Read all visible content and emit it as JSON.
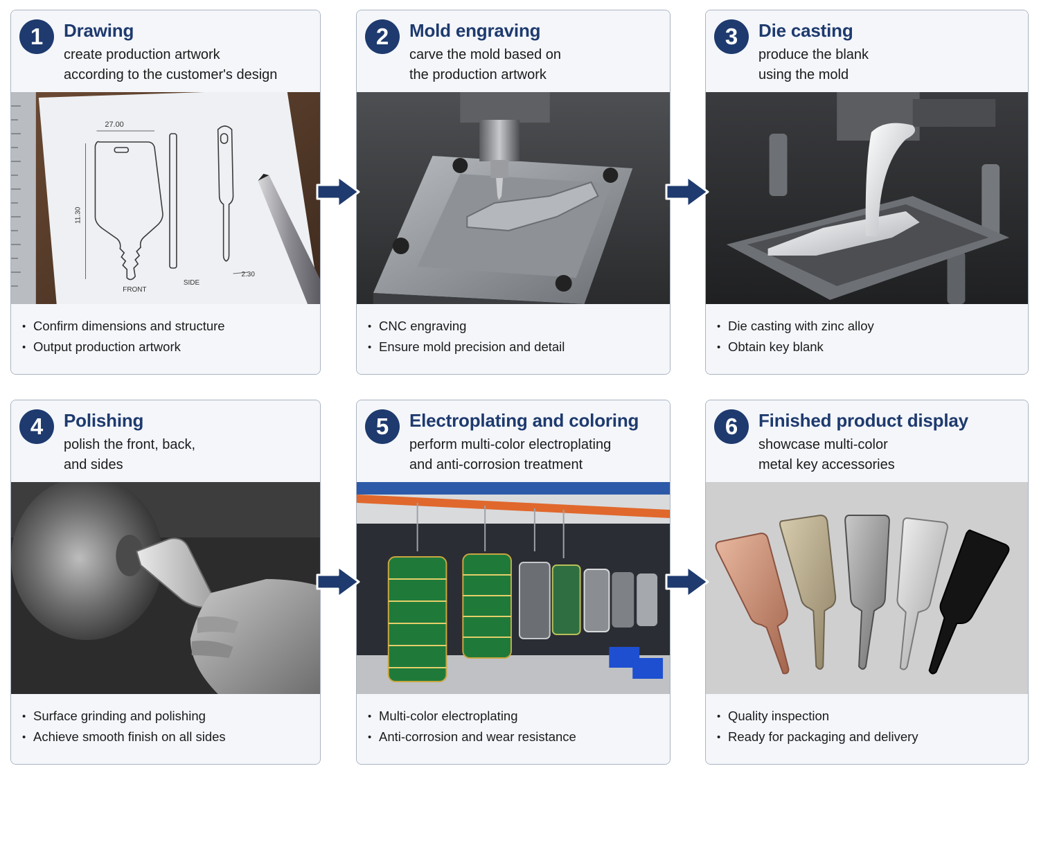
{
  "steps": [
    {
      "number": "1",
      "title": "Drawing",
      "subtitle": [
        "create production artwork",
        "according to the customer's design"
      ],
      "bullets": [
        "Confirm dimensions and structure",
        "Output production artwork"
      ],
      "photo_labels": {
        "width": "27.00",
        "height": "11.30",
        "thickness": "2.30",
        "front": "FRONT",
        "side": "SIDE"
      }
    },
    {
      "number": "2",
      "title": "Mold engraving",
      "subtitle": [
        "carve the mold based on",
        "the production artwork"
      ],
      "bullets": [
        "CNC engraving",
        "Ensure mold precision and detail"
      ]
    },
    {
      "number": "3",
      "title": "Die casting",
      "subtitle": [
        "produce the blank",
        "using the mold"
      ],
      "bullets": [
        "Die casting with zinc alloy",
        "Obtain key blank"
      ]
    },
    {
      "number": "4",
      "title": "Polishing",
      "subtitle": [
        "polish the front, back,",
        "and sides"
      ],
      "bullets": [
        "Surface grinding and polishing",
        "Achieve smooth finish on all sides"
      ]
    },
    {
      "number": "5",
      "title": "Electroplating and coloring",
      "subtitle": [
        "perform multi-color electroplating",
        "and anti-corrosion treatment"
      ],
      "bullets": [
        "Multi-color electroplating",
        "Anti-corrosion and wear resistance"
      ]
    },
    {
      "number": "6",
      "title": "Finished product display",
      "subtitle": [
        "showcase multi-color",
        "metal key accessories"
      ],
      "bullets": [
        "Quality inspection",
        "Ready for packaging and delivery"
      ]
    }
  ],
  "colors": {
    "accent": "#1e3a6e",
    "border": "#aab4c2",
    "panel": "#f4f6fa"
  },
  "icons": [
    "arrow-right-icon"
  ]
}
